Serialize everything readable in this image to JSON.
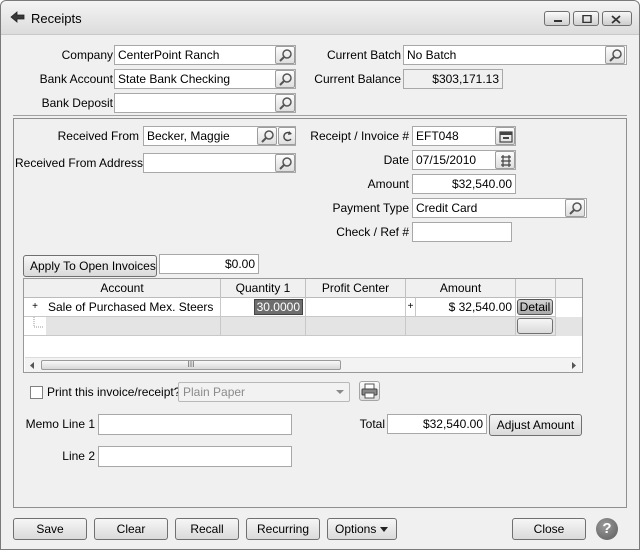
{
  "window": {
    "title": "Receipts"
  },
  "header": {
    "company_label": "Company",
    "company_value": "CenterPoint Ranch",
    "bank_account_label": "Bank Account",
    "bank_account_value": "State Bank Checking",
    "bank_deposit_label": "Bank Deposit",
    "bank_deposit_value": "",
    "current_batch_label": "Current Batch",
    "current_batch_value": "No Batch",
    "current_balance_label": "Current Balance",
    "current_balance_value": "$303,171.13"
  },
  "receipt": {
    "received_from_label": "Received From",
    "received_from_value": "Becker, Maggie",
    "received_from_address_label": "Received From Address",
    "received_from_address_value": "",
    "invoice_label": "Receipt / Invoice #",
    "invoice_value": "EFT048",
    "date_label": "Date",
    "date_value": "07/15/2010",
    "amount_label": "Amount",
    "amount_value": "$32,540.00",
    "payment_type_label": "Payment Type",
    "payment_type_value": "Credit Card",
    "check_ref_label": "Check / Ref #",
    "check_ref_value": ""
  },
  "apply": {
    "button_label": "Apply To Open Invoices",
    "amount_value": "$0.00"
  },
  "grid": {
    "columns": [
      "Account",
      "Quantity 1",
      "Profit Center",
      "Amount"
    ],
    "rows": [
      {
        "expander": "+",
        "account": "Sale of Purchased Mex. Steers",
        "quantity": "30.0000",
        "profit_center": "",
        "split_marker": "+",
        "amount": "$ 32,540.00",
        "action": "Detail"
      }
    ],
    "scroll_grip": "III"
  },
  "print": {
    "checkbox_label": "Print this invoice/receipt?",
    "checked": false,
    "paper_option": "Plain Paper"
  },
  "memo": {
    "line1_label": "Memo Line 1",
    "line1_value": "",
    "line2_label": "Line 2",
    "line2_value": ""
  },
  "totals": {
    "total_label": "Total",
    "total_value": "$32,540.00",
    "adjust_label": "Adjust Amount"
  },
  "footer": {
    "save": "Save",
    "clear": "Clear",
    "recall": "Recall",
    "recurring": "Recurring",
    "options": "Options",
    "close": "Close",
    "help": "?"
  },
  "icons": {
    "title": "receipt-arrow-icon",
    "lookup": "magnifier-icon",
    "refresh": "refresh-icon",
    "calendar": "calendar-icon",
    "printer": "printer-icon",
    "help": "help-icon"
  },
  "colors": {
    "window_bg": "#f0f0f0",
    "field_bg": "#ffffff",
    "selected_text_bg": "#6e6e6e"
  }
}
